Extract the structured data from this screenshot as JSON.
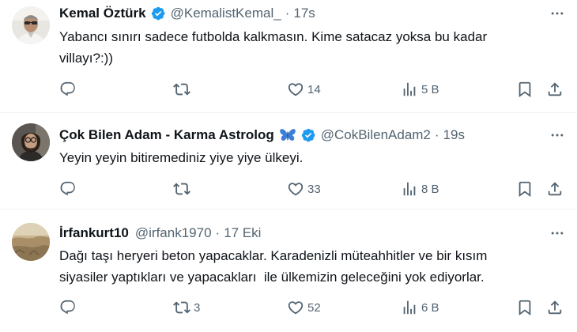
{
  "tweets": [
    {
      "name": "Kemal Öztürk",
      "handle": "@KemalistKemal_",
      "dot": "·",
      "time": "17s",
      "text_lines": [
        "Yabancı sınırı sadece futbolda kalkmasın. Kime satacaz yoksa bu kadar",
        "villayı?:))"
      ],
      "replies": "",
      "retweets": "",
      "likes": "14",
      "views": "5 B"
    },
    {
      "name": "Çok Bilen Adam - Karma Astrolog",
      "handle": "@CokBilenAdam2",
      "dot": "·",
      "time": "19s",
      "text_lines": [
        "Yeyin yeyin bitiremediniz yiye yiye ülkeyi."
      ],
      "replies": "",
      "retweets": "",
      "likes": "33",
      "views": "8 B"
    },
    {
      "name": "İrfankurt10",
      "handle": "@irfank1970",
      "dot": "·",
      "time": "17 Eki",
      "text_lines": [
        "Dağı taşı heryeri beton yapacaklar. Karadenizli müteahhitler ve bir kısım",
        "siyasiler yaptıkları ve yapacakları  ile ülkemizin geleceğini yok ediyorlar."
      ],
      "replies": "",
      "retweets": "3",
      "likes": "52",
      "views": "6 B"
    }
  ],
  "colors": {
    "verified": "#1d9bf0",
    "secondary_text": "#536471",
    "primary_text": "#0f1419",
    "divider": "#eff3f4",
    "butterfly": "#3b7fd8"
  },
  "icons": [
    "verified-badge-icon",
    "butterfly-emoji-icon",
    "more-icon",
    "reply-icon",
    "retweet-icon",
    "like-icon",
    "views-icon",
    "bookmark-icon",
    "share-icon"
  ]
}
